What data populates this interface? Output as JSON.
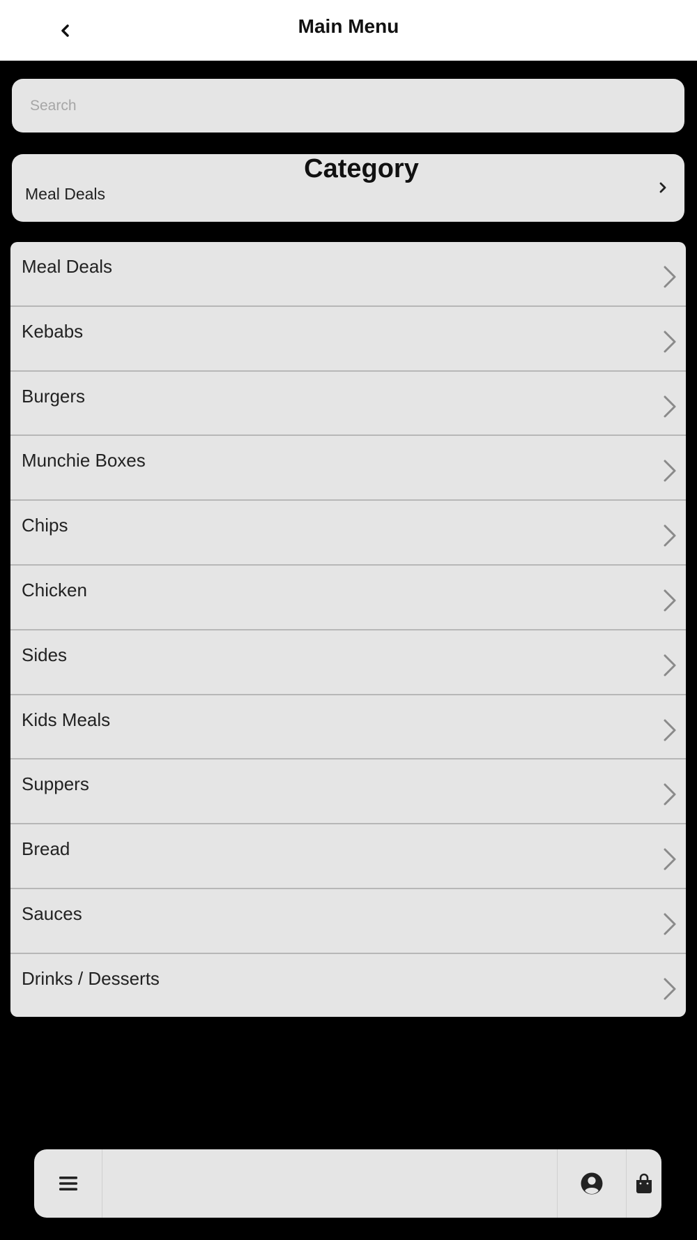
{
  "header": {
    "title": "Main Menu",
    "back_icon": "chevron-left-icon"
  },
  "search": {
    "placeholder": "Search",
    "value": ""
  },
  "category": {
    "title": "Category",
    "selected": "Meal Deals",
    "icon": "chevron-right-icon"
  },
  "menu_items": [
    {
      "label": "Meal Deals"
    },
    {
      "label": "Kebabs"
    },
    {
      "label": "Burgers"
    },
    {
      "label": "Munchie Boxes"
    },
    {
      "label": "Chips"
    },
    {
      "label": "Chicken"
    },
    {
      "label": "Sides"
    },
    {
      "label": "Kids Meals"
    },
    {
      "label": "Suppers"
    },
    {
      "label": "Bread"
    },
    {
      "label": "Sauces"
    },
    {
      "label": "Drinks / Desserts"
    }
  ],
  "bottom_bar": {
    "menu_icon": "hamburger-menu-icon",
    "account_icon": "user-circle-icon",
    "bag_icon": "shopping-bag-icon"
  },
  "colors": {
    "background": "#000000",
    "surface": "#e5e5e5",
    "header": "#ffffff",
    "divider": "#b7b7b7",
    "chevron": "#8a8a8a"
  }
}
